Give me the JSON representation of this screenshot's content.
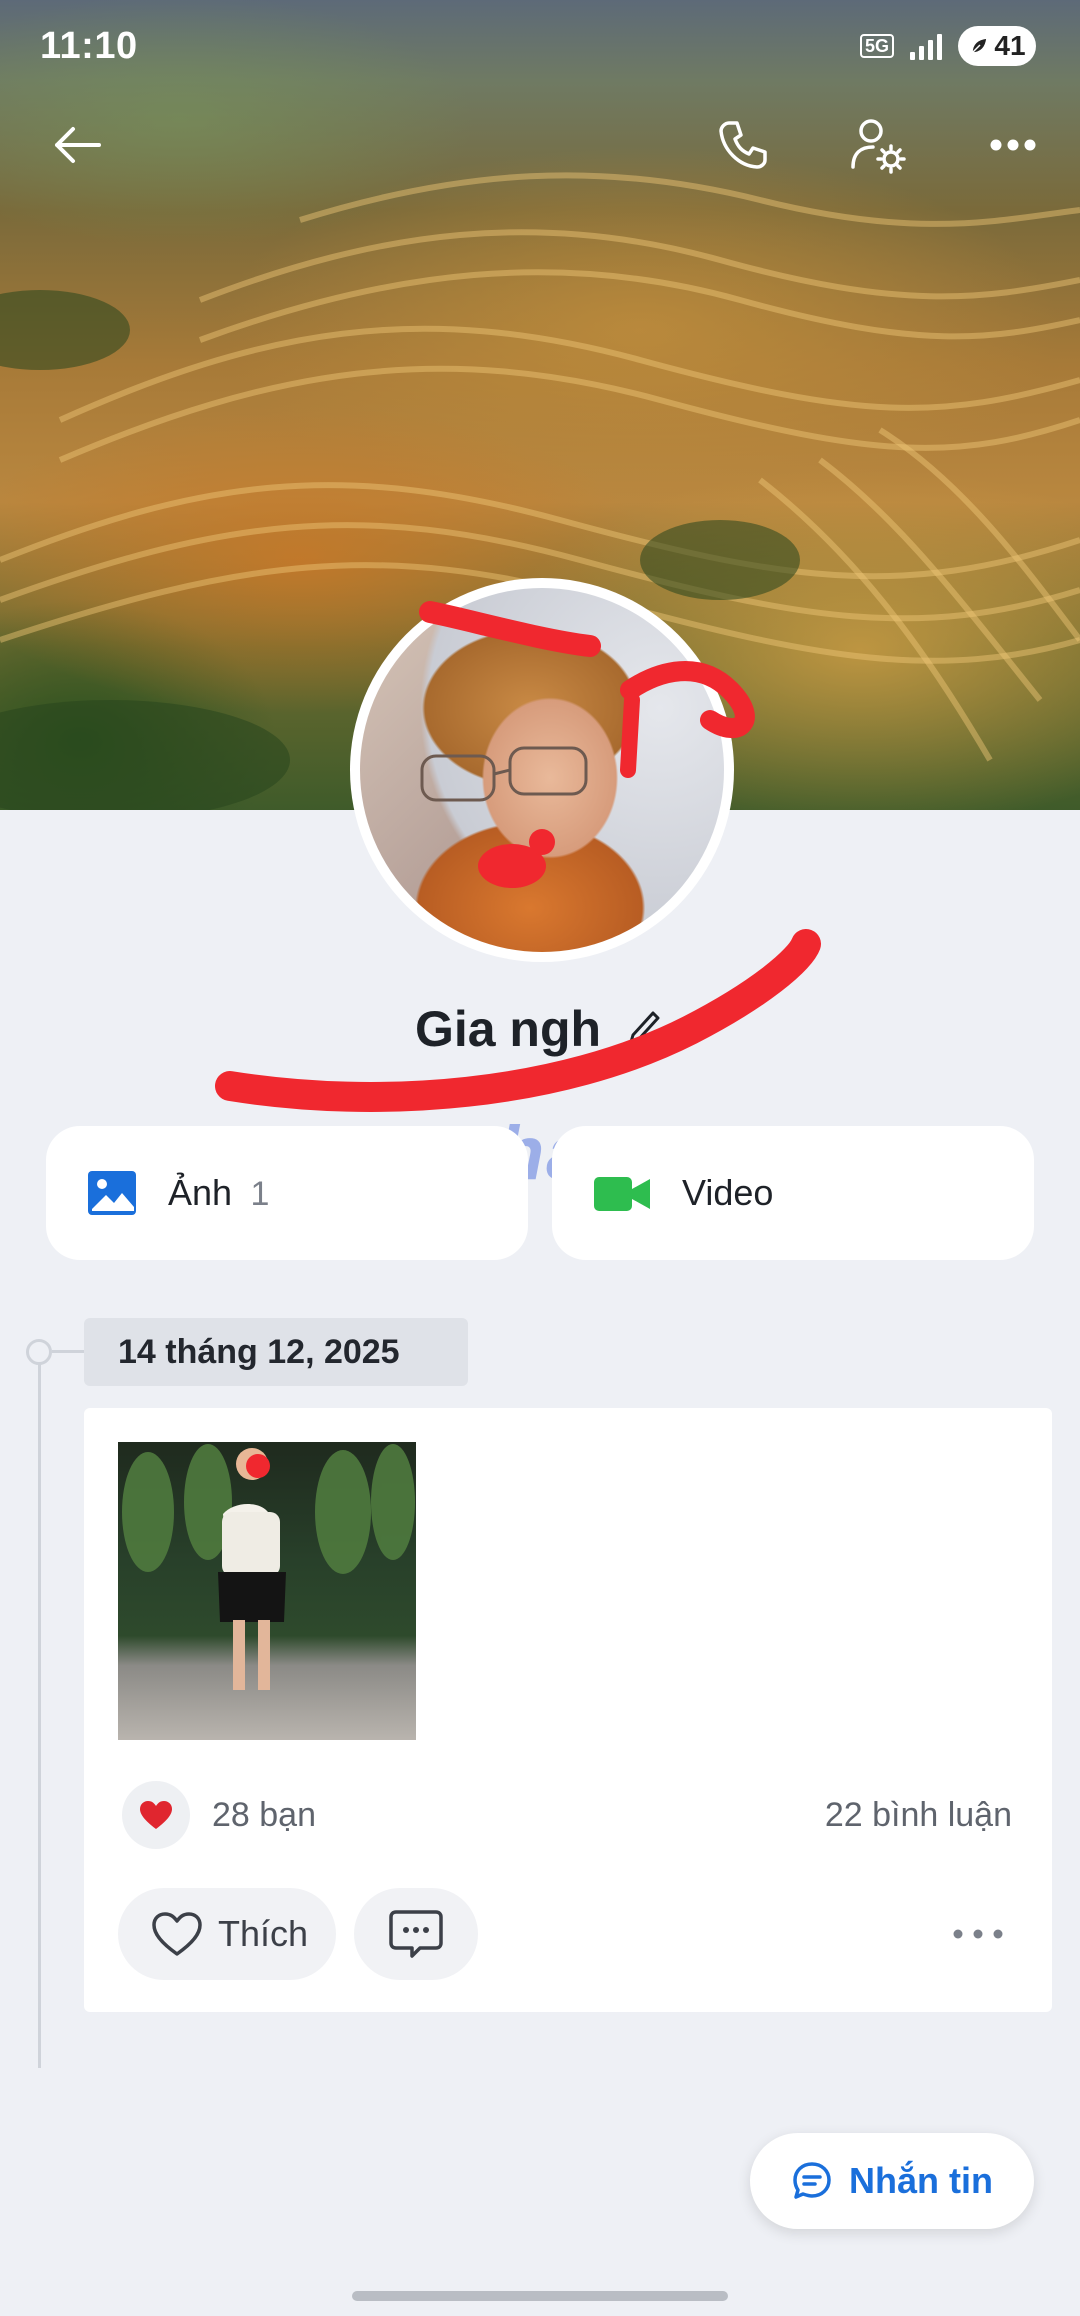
{
  "status_bar": {
    "time": "11:10",
    "network": "5G",
    "battery": "41"
  },
  "header": {
    "back_icon": "back-arrow-icon",
    "call_icon": "phone-icon",
    "settings_icon": "user-settings-icon",
    "more_icon": "more-horizontal-icon"
  },
  "profile": {
    "name": "Gia ngh"
  },
  "watermark": "Rphang",
  "media": {
    "photos_label": "Ảnh",
    "photos_count": "1",
    "video_label": "Video"
  },
  "timeline": {
    "date": "14 tháng 12, 2025"
  },
  "post": {
    "reactions_label": "28 bạn",
    "comments_label": "22 bình luận",
    "like_label": "Thích"
  },
  "message_button": {
    "label": "Nhắn tin"
  },
  "colors": {
    "accent": "#1a6fdb",
    "background": "#eef0f5",
    "heart": "#e0262f",
    "video": "#2ebd4f",
    "scribble": "#f0282f"
  }
}
